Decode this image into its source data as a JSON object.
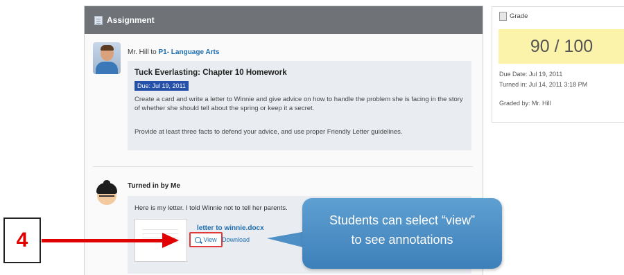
{
  "assignment_panel": {
    "header": "Assignment",
    "teacher": "Mr. Hill",
    "to_word": " to ",
    "class_name": "P1- Language Arts",
    "title": "Tuck Everlasting: Chapter 10 Homework",
    "due_badge": "Due: Jul 19, 2011",
    "description_1": "Create a card and write a letter to Winnie and give advice on how to handle the problem she is facing in the story of whether she should tell about the spring or keep it a secret.",
    "description_2": "Provide at least three facts to defend your advice, and use proper Friendly Letter guidelines.",
    "turned_in_label": "Turned in by Me",
    "submission_message": "Here is my letter. I told Winnie not to tell her parents.",
    "file_name": "letter to winnie.docx",
    "view_label": "View",
    "download_label": "Download"
  },
  "grade_panel": {
    "header": "Grade",
    "score": "90 / 100",
    "due_date": "Due Date: Jul 19, 2011",
    "turned_in": "Turned in: Jul 14, 2011 3:18 PM",
    "graded_by": "Graded by: Mr. Hill"
  },
  "callout": {
    "line1": "Students can select “view”",
    "line2": "to see annotations"
  },
  "step": {
    "number": "4"
  },
  "colors": {
    "header_bg": "#6f7378",
    "link": "#1c6db0",
    "due_badge_bg": "#2450a8",
    "grade_bg": "#fbf3a9",
    "callout_bg": "#4e8fc6",
    "arrow": "#e00000"
  },
  "icons": [
    "assignment-doc-icon",
    "grade-doc-icon",
    "magnifier-icon",
    "arrow-right-icon"
  ]
}
